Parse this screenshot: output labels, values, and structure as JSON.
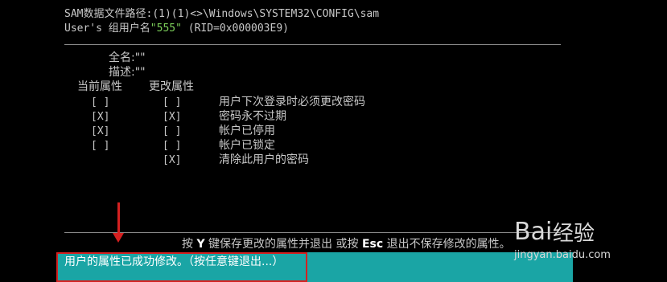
{
  "header": {
    "sam_path_label": "SAM数据文件路径:",
    "sam_path_value": "(1)(1)<>\\Windows\\SYSTEM32\\CONFIG\\sam",
    "user_prefix": "User's 组用户名",
    "user_name": "\"555\"",
    "rid": " (RID=0x000003E9)"
  },
  "fields": {
    "full_name": "全名:\"\"",
    "description": "描述:\"\""
  },
  "columns": {
    "current": "当前属性",
    "change": "更改属性"
  },
  "attributes": [
    {
      "current": "[ ]",
      "change": "[ ]",
      "label": "用户下次登录时必须更改密码"
    },
    {
      "current": "[X]",
      "change": "[X]",
      "label": "密码永不过期"
    },
    {
      "current": "[X]",
      "change": "[ ]",
      "label": "帐户已停用"
    },
    {
      "current": "[ ]",
      "change": "[ ]",
      "label": "帐户已锁定"
    },
    {
      "current": "",
      "change": "[X]",
      "label": "清除此用户的密码"
    }
  ],
  "prompt": {
    "press": "按 ",
    "y_key": "Y",
    "save_text": " 键保存更改的属性并退出 或按 ",
    "esc_key": "Esc",
    "exit_text": " 退出不保存修改的属性。"
  },
  "status": {
    "message": "用户的属性已成功修改。（按任意键退出...）"
  },
  "watermark": {
    "logo": "Bai",
    "name": "经验",
    "url": "jingyan.baidu.com"
  },
  "colors": {
    "background": "#000000",
    "text": "#c8c8c8",
    "highlight": "#7ccf5a",
    "status_bar": "#1aa5a5",
    "annotation": "#d42020"
  }
}
